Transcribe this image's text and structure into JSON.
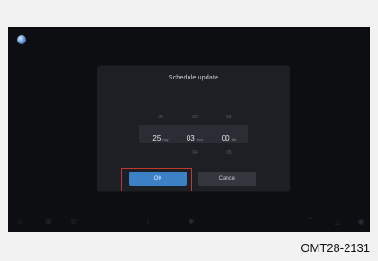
{
  "dialog": {
    "title": "Schedule update",
    "picker": {
      "day": {
        "above": "24",
        "selected": "25",
        "unit": "Day",
        "below": ""
      },
      "hour": {
        "above": "02",
        "selected": "03",
        "unit": "Hour",
        "below": "04"
      },
      "minute": {
        "above": "55",
        "selected": "00",
        "unit": "Min",
        "below": "05"
      }
    },
    "ok_label": "OK",
    "cancel_label": "Cancel"
  },
  "bottom_bar": {
    "icons": [
      "home-icon",
      "apps-icon",
      "phone-icon",
      "media-icon",
      "fan-icon",
      "seat-icon",
      "settings-icon",
      "volume-icon"
    ]
  },
  "caption": "OMT28-2131",
  "colors": {
    "screen_bg": "#0c0e11",
    "dialog_bg": "#1c1f24",
    "ok_button": "#3c80c6",
    "cancel_button": "#34383e",
    "highlight": "#c0392b"
  }
}
